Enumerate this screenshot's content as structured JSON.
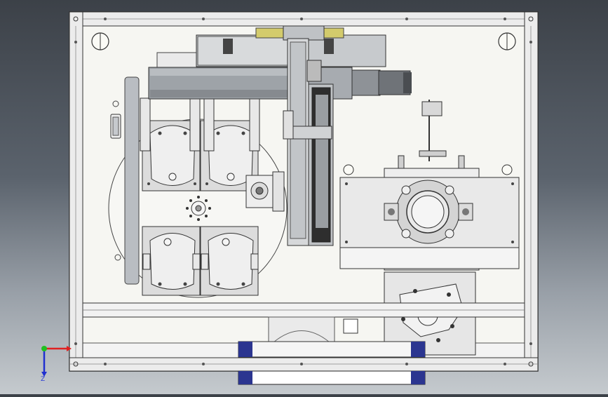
{
  "viewport": {
    "background_top": "#3c4148",
    "background_bottom": "#c5cace"
  },
  "triad": {
    "x_color": "#e02020",
    "y_color": "#20c020",
    "z_color": "#2030d0",
    "z_label": "Z"
  },
  "colors": {
    "frame": "#f4f4f4",
    "outline": "#2b2b2b",
    "steel": "#9aa0a6",
    "steel_dark": "#6e7379",
    "plate": "#e9e9e9",
    "brass": "#c9c060",
    "blue": "#2b3590"
  }
}
